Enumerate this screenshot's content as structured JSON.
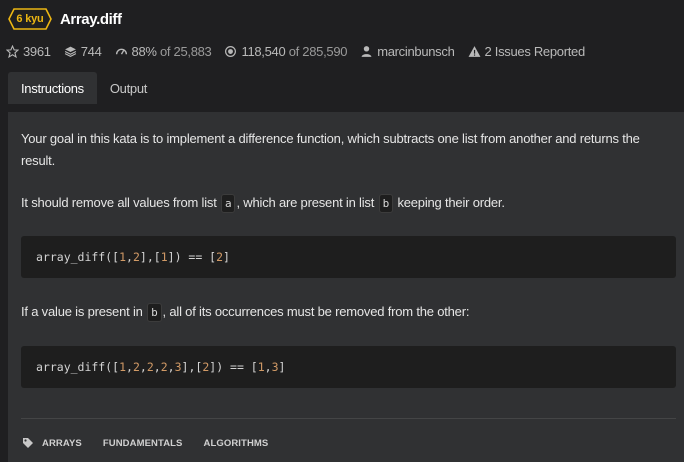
{
  "kata": {
    "rank": "6 kyu",
    "title": "Array.diff",
    "rank_color": "#ecb613"
  },
  "stats": {
    "stars": "3961",
    "collections": "744",
    "satisfaction_pct": "88%",
    "satisfaction_of": "of 25,883",
    "completions": "118,540",
    "completions_of": "of 285,590",
    "author": "marcinbunsch",
    "issues": "2 Issues Reported"
  },
  "tabs": [
    {
      "label": "Instructions",
      "active": true
    },
    {
      "label": "Output",
      "active": false
    }
  ],
  "instructions": {
    "p1": "Your goal in this kata is to implement a difference function, which subtracts one list from another and returns the result.",
    "p2_before": "It should remove all values from list",
    "p2_code_a": "a",
    "p2_middle": ", which are present in list",
    "p2_code_b": "b",
    "p2_after": "keeping their order.",
    "code1": {
      "fn": "array_diff(",
      "tokens": [
        "[",
        "1",
        ",",
        "2",
        "],[",
        "1",
        "]) == [",
        "2",
        "]"
      ]
    },
    "p3_before": "If a value is present in",
    "p3_code_b": "b",
    "p3_after": ", all of its occurrences must be removed from the other:",
    "code2": {
      "fn": "array_diff(",
      "tokens": [
        "[",
        "1",
        ",",
        "2",
        ",",
        "2",
        ",",
        "2",
        ",",
        "3",
        "],[",
        "2",
        "]) == [",
        "1",
        ",",
        "3",
        "]"
      ]
    }
  },
  "tags": [
    "ARRAYS",
    "FUNDAMENTALS",
    "ALGORITHMS"
  ]
}
